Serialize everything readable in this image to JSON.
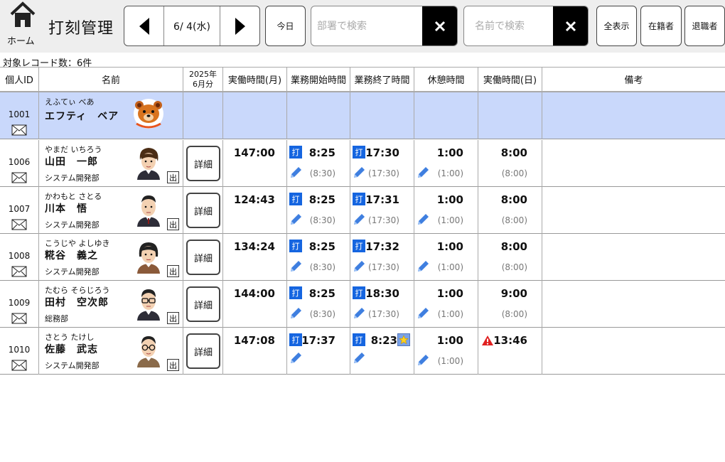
{
  "header": {
    "home_label": "ホーム",
    "title": "打刻管理",
    "date": "6/ 4(水)",
    "today_label": "今日",
    "dept_search_placeholder": "部署で検索",
    "name_search_placeholder": "名前で検索",
    "show_all_label": "全表示",
    "present_label": "在籍者",
    "retired_label": "退職者"
  },
  "record_count": "対象レコード数：6件",
  "columns": {
    "id": "個人ID",
    "name": "名前",
    "month_year": "2025年",
    "month_label": "6月分",
    "monthly_hours": "実働時間(月)",
    "start_time": "業務開始時間",
    "end_time": "業務終了時間",
    "break": "休憩時間",
    "daily_hours": "実働時間(日)",
    "remarks": "備考"
  },
  "stamp_label": "打",
  "detail_label": "詳細",
  "out_label": "出",
  "rows": [
    {
      "id": "1001",
      "kana": "えふてぃ べあ",
      "name": "エフティ　ベア",
      "dept": "",
      "avatar": "bear-avatar"
    },
    {
      "id": "1006",
      "kana": "やまだ いちろう",
      "name": "山田　一郎",
      "dept": "システム開発部",
      "monthly": "147:00",
      "start": "8:25",
      "start_sched": "(8:30)",
      "end": "17:30",
      "end_sched": "(17:30)",
      "break": "1:00",
      "break_sched": "(1:00)",
      "daily": "8:00",
      "daily_sched": "(8:00)"
    },
    {
      "id": "1007",
      "kana": "かわもと さとる",
      "name": "川本　悟",
      "dept": "システム開発部",
      "monthly": "124:43",
      "start": "8:25",
      "start_sched": "(8:30)",
      "end": "17:31",
      "end_sched": "(17:30)",
      "break": "1:00",
      "break_sched": "(1:00)",
      "daily": "8:00",
      "daily_sched": "(8:00)"
    },
    {
      "id": "1008",
      "kana": "こうじや よしゆき",
      "name": "糀谷　義之",
      "dept": "システム開発部",
      "monthly": "134:24",
      "start": "8:25",
      "start_sched": "(8:30)",
      "end": "17:32",
      "end_sched": "(17:30)",
      "break": "1:00",
      "break_sched": "(1:00)",
      "daily": "8:00",
      "daily_sched": "(8:00)"
    },
    {
      "id": "1009",
      "kana": "たむら そらじろう",
      "name": "田村　空次郎",
      "dept": "総務部",
      "monthly": "144:00",
      "start": "8:25",
      "start_sched": "(8:30)",
      "end": "18:30",
      "end_sched": "(17:30)",
      "break": "1:00",
      "break_sched": "(1:00)",
      "daily": "9:00",
      "daily_sched": "(8:00)"
    },
    {
      "id": "1010",
      "kana": "さとう たけし",
      "name": "佐藤　武志",
      "dept": "システム開発部",
      "monthly": "147:08",
      "start": "17:37",
      "end": "8:23",
      "break": "1:00",
      "break_sched": "(1:00)",
      "daily": "13:46"
    }
  ],
  "colors": {
    "selected_row": "#c9d8fb",
    "stamp": "#1565e0",
    "pencil": "#3f7fe0",
    "warning": "#e02020"
  }
}
